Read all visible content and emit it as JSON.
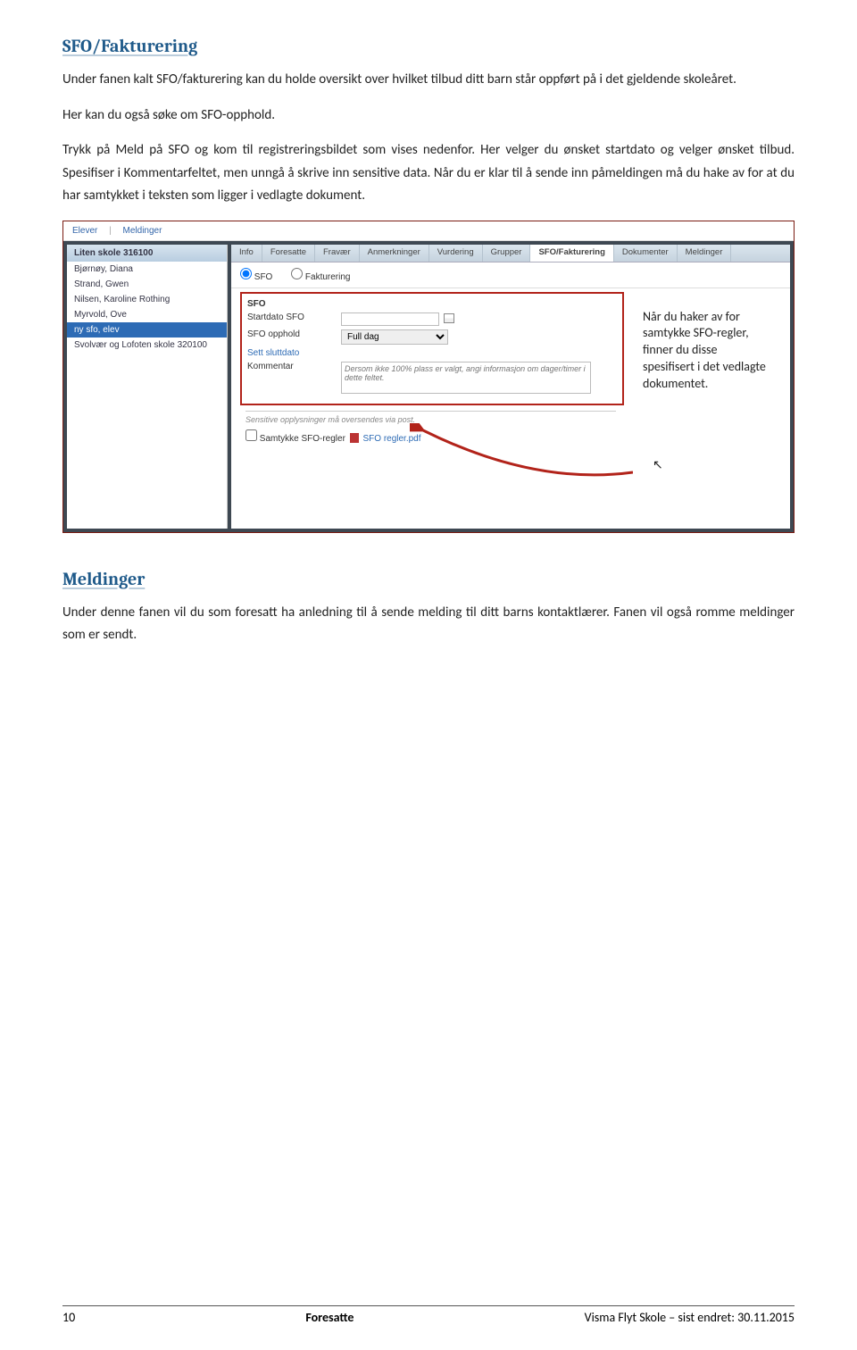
{
  "section1": {
    "heading": "SFO/Fakturering",
    "para1": "Under fanen kalt SFO/fakturering kan du holde oversikt over hvilket tilbud ditt barn står oppført på i det gjeldende skoleåret.",
    "para2": "Her kan du også søke om SFO-opphold.",
    "para3": "Trykk på Meld på SFO og kom til registreringsbildet som vises nedenfor. Her velger du ønsket startdato og velger ønsket tilbud. Spesifiser i Kommentarfeltet, men unngå å skrive inn sensitive data. Når du er klar til å sende inn påmeldingen må du hake av for at du har samtykket i teksten som ligger i vedlagte dokument."
  },
  "figure": {
    "topbar": {
      "elever": "Elever",
      "meldinger": "Meldinger"
    },
    "sidebar": {
      "header": "Liten skole 316100",
      "items": [
        "Bjørnøy, Diana",
        "Strand, Gwen",
        "Nilsen, Karoline Rothing",
        "Myrvold, Ove",
        "ny sfo, elev",
        "Svolvær og Lofoten skole 320100"
      ],
      "selected_index": 4
    },
    "tabs": {
      "items": [
        "Info",
        "Foresatte",
        "Fravær",
        "Anmerkninger",
        "Vurdering",
        "Grupper",
        "SFO/Fakturering",
        "Dokumenter",
        "Meldinger"
      ],
      "active": "SFO/Fakturering"
    },
    "radios": {
      "sfo": "SFO",
      "fakturering": "Fakturering"
    },
    "form": {
      "heading": "SFO",
      "startdato_label": "Startdato SFO",
      "startdato_value": "",
      "opphold_label": "SFO opphold",
      "opphold_value": "Full dag",
      "sluttdato_label": "Sett sluttdato",
      "kommentar_label": "Kommentar",
      "kommentar_placeholder": "Dersom ikke 100% plass er valgt, angi informasjon om dager/timer i dette feltet.",
      "sensitive_note": "Sensitive opplysninger må oversendes via post.",
      "consent_label": "Samtykke SFO-regler",
      "consent_doc": "SFO regler.pdf"
    },
    "callout": "Når du haker av for samtykke SFO-regler, finner du disse spesifisert i det vedlagte dokumentet."
  },
  "section2": {
    "heading": "Meldinger",
    "para1": "Under denne fanen vil du som foresatt ha anledning til å sende melding til ditt barns kontaktlærer. Fanen vil også romme meldinger som er sendt."
  },
  "footer": {
    "left": "10",
    "center": "Foresatte",
    "right": "Visma Flyt Skole – sist endret: 30.11.2015"
  }
}
